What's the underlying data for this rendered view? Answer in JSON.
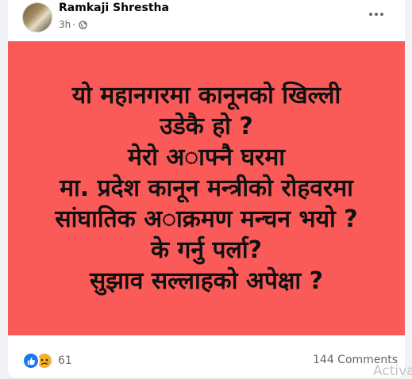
{
  "post": {
    "author": "Ramkaji Shrestha",
    "time": "3h",
    "dot": "·",
    "privacy_icon": "globe-icon",
    "more_icon": "more-options-icon"
  },
  "content": {
    "background_color": "#fb5b58",
    "lines": [
      "यो महानगरमा कानूनको खिल्ली",
      "उडेकै हो ?",
      "मेरो अाफ्नै घरमा",
      "मा. प्रदेश कानून मन्त्रीको रोहवरमा",
      "सांघातिक अाक्रमण मन्चन भयो ?",
      "के गर्नु पर्ला?",
      "सुझाव सल्लाहको अपेक्षा ?"
    ]
  },
  "footer": {
    "reaction_icons": [
      "like-icon",
      "sad-icon"
    ],
    "reaction_count": "61",
    "comments": "144 Comments"
  },
  "overlay": {
    "watermark": "Activa"
  }
}
